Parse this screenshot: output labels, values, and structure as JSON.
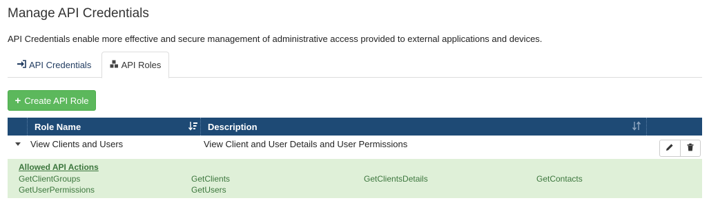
{
  "page": {
    "title": "Manage API Credentials",
    "description": "API Credentials enable more effective and secure management of administrative access provided to external applications and devices."
  },
  "tabs": [
    {
      "label": "API Credentials",
      "icon": "sign-in-icon",
      "active": false
    },
    {
      "label": "API Roles",
      "icon": "cubes-icon",
      "active": true
    }
  ],
  "toolbar": {
    "create_label": "Create API Role"
  },
  "table": {
    "columns": [
      "Role Name",
      "Description"
    ],
    "rows": [
      {
        "role_name": "View Clients and Users",
        "description": "View Client and User Details and User Permissions",
        "expanded": true,
        "details": {
          "title": "Allowed API Actions",
          "actions": [
            "GetClientGroups",
            "GetClients",
            "GetClientsDetails",
            "GetContacts",
            "GetUserPermissions",
            "GetUsers"
          ]
        }
      }
    ]
  },
  "colors": {
    "header_bg": "#1e4a75",
    "create_button": "#5cb85c",
    "details_bg": "#dff0d8",
    "details_text": "#3c763d"
  }
}
